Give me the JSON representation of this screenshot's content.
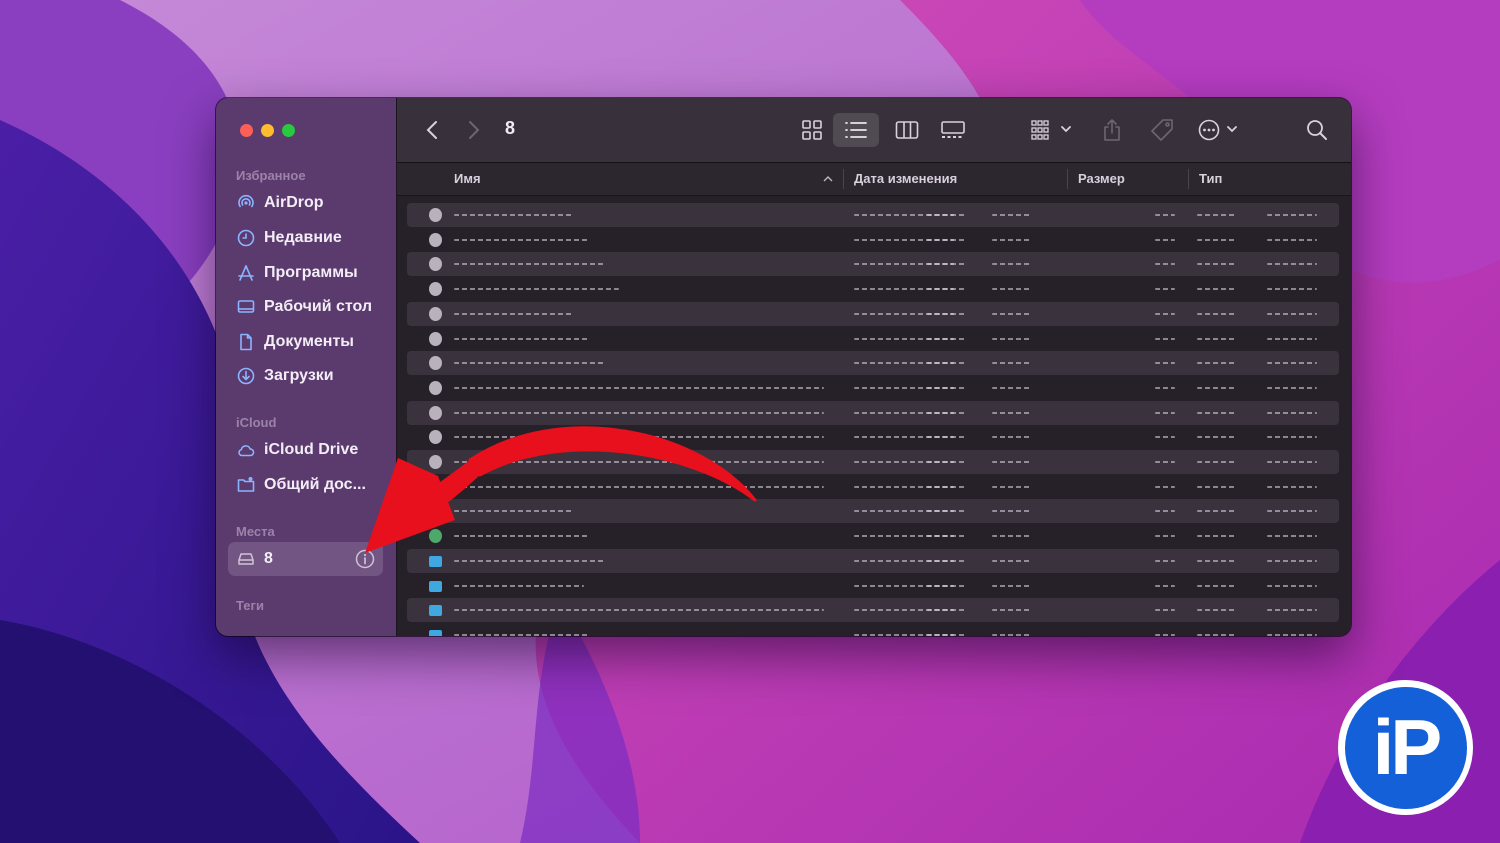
{
  "window": {
    "title": "8"
  },
  "sidebar": {
    "favorites_header": "Избранное",
    "favorites": [
      {
        "label": "AirDrop",
        "icon": "airdrop-icon"
      },
      {
        "label": "Недавние",
        "icon": "clock-icon"
      },
      {
        "label": "Программы",
        "icon": "applications-icon"
      },
      {
        "label": "Рабочий стол",
        "icon": "desktop-icon"
      },
      {
        "label": "Документы",
        "icon": "document-icon"
      },
      {
        "label": "Загрузки",
        "icon": "download-icon"
      }
    ],
    "icloud_header": "iCloud",
    "icloud": [
      {
        "label": "iCloud Drive",
        "icon": "cloud-icon"
      },
      {
        "label": "Общий дос...",
        "icon": "shared-folder-icon"
      }
    ],
    "locations_header": "Места",
    "locations": [
      {
        "label": "8",
        "icon": "drive-icon"
      }
    ],
    "tags_header": "Теги"
  },
  "columns": {
    "name": "Имя",
    "date_modified": "Дата изменения",
    "size": "Размер",
    "kind": "Тип"
  },
  "colors": {
    "accent_icon": "#8bb4ff",
    "arrow": "#e8101c",
    "folder": "#3fa8e0",
    "logo_blue": "#1460d8"
  },
  "logo": {
    "text": "iP"
  }
}
